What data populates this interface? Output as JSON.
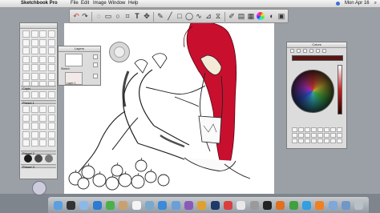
{
  "menubar": {
    "app_name": "Sketchbook Pro",
    "items": [
      "File",
      "Edit",
      "Image",
      "Window",
      "Help"
    ],
    "clock": "Mon Apr 16"
  },
  "toolbar": {
    "buttons": [
      "undo-icon",
      "redo-icon",
      "lasso-icon",
      "crop-icon",
      "rect-select-icon",
      "ellipse-icon",
      "transform-icon",
      "text-icon",
      "move-icon",
      "pen-icon",
      "line-icon",
      "rectangle-icon",
      "ellipse-shape-icon",
      "ruler-icon",
      "curve-icon",
      "symmetry-icon",
      "brush-icon",
      "color-wheel-icon",
      "brush-palette-icon",
      "lagoon-icon"
    ]
  },
  "palette": {
    "section_copic": "Copic",
    "section_preset1": "Preset 1",
    "section_preset2": "Preset 2",
    "section_preset3": "Preset 3"
  },
  "layers_panel": {
    "title": "Layers",
    "layer_top": "Sketch",
    "layer_bottom": "Layer 1"
  },
  "colors_panel": {
    "title": "Colors",
    "current_color": "#5a1414",
    "accent": "#c82020"
  },
  "canvas": {
    "background": "#ffffff",
    "hair_color": "#c8102e"
  },
  "dock": {
    "icons": [
      "finder-icon",
      "dashboard-icon",
      "mail-icon",
      "safari-icon",
      "ichat-icon",
      "address-book-icon",
      "ical-icon",
      "preview-icon",
      "iphoto-icon",
      "itunes-icon",
      "imovie-icon",
      "garageband-icon",
      "photoshop-icon",
      "sketchbook-icon",
      "textedit-icon",
      "system-preferences-icon",
      "terminal-icon",
      "firefox-icon",
      "chrome-icon",
      "skype-icon",
      "vlc-icon",
      "folder-icon",
      "downloads-icon",
      "trash-icon"
    ]
  }
}
